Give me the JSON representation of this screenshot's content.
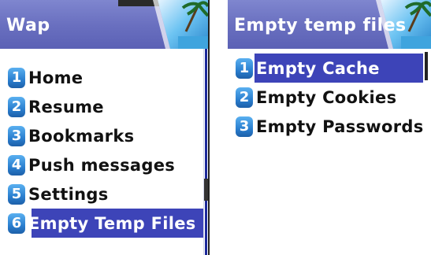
{
  "left_screen": {
    "title": "Wap",
    "items": [
      {
        "number": "1",
        "label": "Home"
      },
      {
        "number": "2",
        "label": "Resume"
      },
      {
        "number": "3",
        "label": "Bookmarks"
      },
      {
        "number": "4",
        "label": "Push messages"
      },
      {
        "number": "5",
        "label": "Settings"
      },
      {
        "number": "6",
        "label": "Empty Temp Files"
      }
    ],
    "selected_index": 5
  },
  "right_screen": {
    "title": "Empty temp files",
    "items": [
      {
        "number": "1",
        "label": "Empty Cache"
      },
      {
        "number": "2",
        "label": "Empty Cookies"
      },
      {
        "number": "3",
        "label": "Empty Passwords"
      }
    ],
    "selected_index": 0
  },
  "colors": {
    "titlebar": "#6a70c0",
    "highlight": "#3d44b8",
    "badge": "#2a7fd0"
  },
  "icons": {
    "title_art": "beach-palm-picture-icon",
    "number_badge": "numbered-blue-badge-icon"
  }
}
